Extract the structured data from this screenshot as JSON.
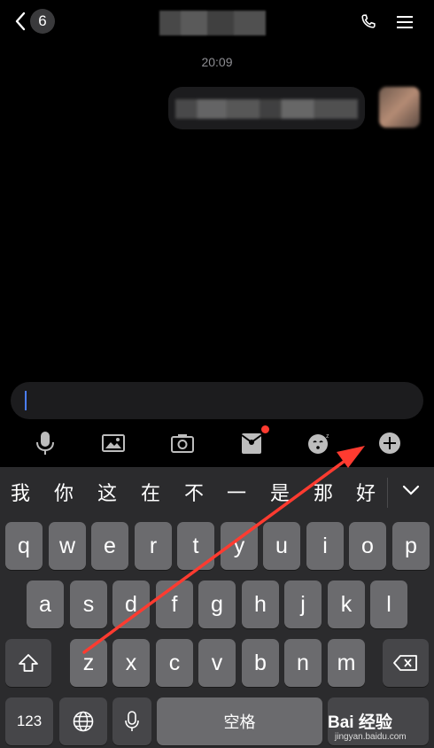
{
  "header": {
    "back_count": "6",
    "time": "20:09"
  },
  "input": {
    "value": ""
  },
  "toolbar": {
    "icons": [
      "microphone-icon",
      "image-icon",
      "camera-icon",
      "red-packet-icon",
      "emoji-icon",
      "plus-icon"
    ]
  },
  "candidates": [
    "我",
    "你",
    "这",
    "在",
    "不",
    "一",
    "是",
    "那",
    "好"
  ],
  "keys": {
    "row1": [
      "q",
      "w",
      "e",
      "r",
      "t",
      "y",
      "u",
      "i",
      "o",
      "p"
    ],
    "row2": [
      "a",
      "s",
      "d",
      "f",
      "g",
      "h",
      "j",
      "k",
      "l"
    ],
    "row3": [
      "z",
      "x",
      "c",
      "v",
      "b",
      "n",
      "m"
    ],
    "numbers": "123",
    "space": "空格"
  },
  "watermark": {
    "main": "Bai 经验",
    "sub": "jingyan.baidu.com"
  },
  "colors": {
    "annotation_arrow": "#ff3b30",
    "red_dot": "#ff3b30",
    "caret": "#4a7dff"
  }
}
